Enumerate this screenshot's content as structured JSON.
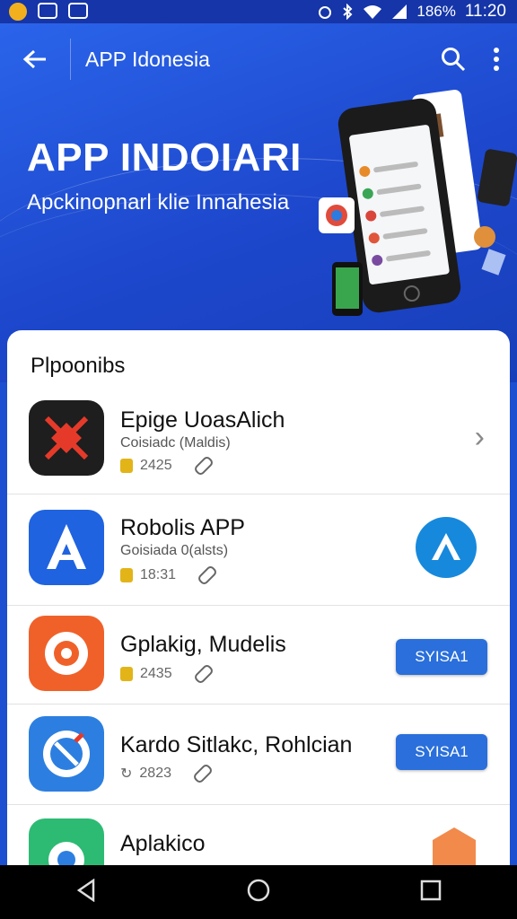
{
  "status_bar": {
    "battery": "186%",
    "time": "11:20"
  },
  "header": {
    "title": "APP Idonesia"
  },
  "hero": {
    "title": "APP INDOIARI",
    "subtitle": "Apckinopnarl klie Innahesia"
  },
  "section": {
    "title": "Plpoonibs"
  },
  "apps": [
    {
      "name": "Epige UoasAlich",
      "subtitle": "Coisiadc (Maldis)",
      "meta": "2425"
    },
    {
      "name": "Robolis APP",
      "subtitle": "Goisiada 0(alsts)",
      "meta": "18:31"
    },
    {
      "name": "Gplakig, Mudelis",
      "meta": "2435",
      "button": "SYISA1"
    },
    {
      "name": "Kardo Sitlakc, Rohlcian",
      "meta": "2823",
      "button": "SYISA1"
    },
    {
      "name": "Aplakico"
    }
  ],
  "colors": {
    "brand": "#1d4fd1",
    "button": "#2a6fdb"
  }
}
